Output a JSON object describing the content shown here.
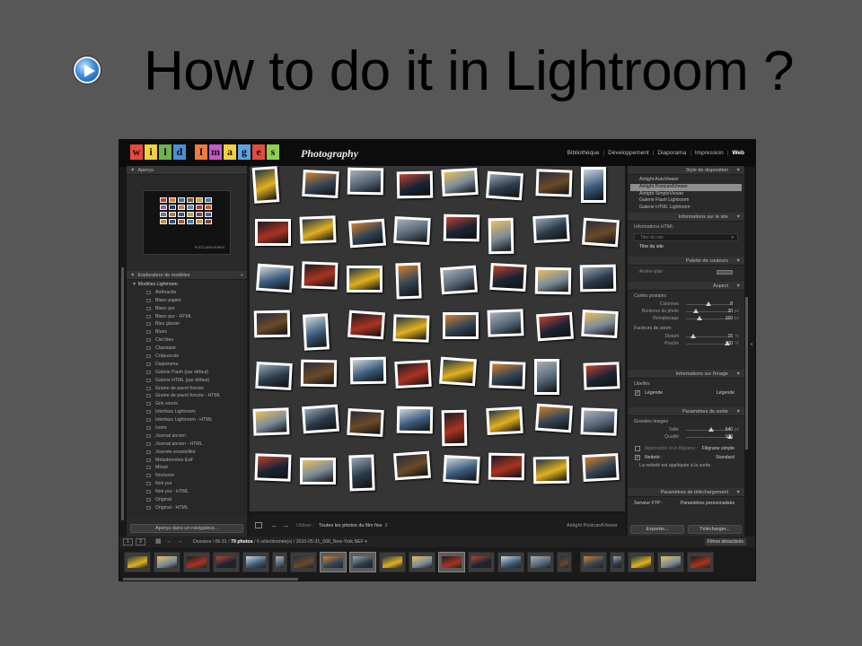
{
  "slide": {
    "title": "How to do it in Lightroom ?"
  },
  "lr": {
    "logo": [
      {
        "ch": "w",
        "bg": "#e64a3c"
      },
      {
        "ch": "i",
        "bg": "#f2d03a"
      },
      {
        "ch": "l",
        "bg": "#6fb24e"
      },
      {
        "ch": "d",
        "bg": "#4c8fd6"
      },
      {
        "ch": "",
        "bg": "transparent"
      },
      {
        "ch": "I",
        "bg": "#ef7c3a"
      },
      {
        "ch": "m",
        "bg": "#c45ac9"
      },
      {
        "ch": "a",
        "bg": "#f2d03a"
      },
      {
        "ch": "g",
        "bg": "#5aa6e0"
      },
      {
        "ch": "e",
        "bg": "#e64a3c"
      },
      {
        "ch": "s",
        "bg": "#8fd14f"
      }
    ],
    "logo_caption": "Photography",
    "modules": [
      {
        "label": "Bibliothèque",
        "active": false
      },
      {
        "label": "Développement",
        "active": false
      },
      {
        "label": "Diaporama",
        "active": false
      },
      {
        "label": "Impression",
        "active": false
      },
      {
        "label": "Web",
        "active": true
      }
    ],
    "left_panel": {
      "preview_header": "Aperçu",
      "preview_signature": "POSTCARDVIEWER",
      "explorer_header": "Explorateur de modèles",
      "folder": "Modèles Lightroom",
      "templates": [
        "Anthracite",
        "Blanc papier",
        "Blanc pur",
        "Blanc pur - HTML",
        "Bleu glacier",
        "Blues",
        "Ciel bleu",
        "Classique",
        "Crépuscule",
        "Diaporama",
        "Galerie Flash (par défaut)",
        "Galerie HTML (par défaut)",
        "Graine de pavot foncée",
        "Graine de pavot foncée - HTML",
        "Gris souris",
        "Interface Lightroom",
        "Interface Lightroom - HTML",
        "Ivoire",
        "Journal ancien",
        "Journal ancien - HTML",
        "Journée ensoleillée",
        "Métadonnées Exif",
        "Minuit",
        "Nocturne",
        "Noir pur",
        "Noir pur - HTML",
        "Original",
        "Original - HTML"
      ],
      "preview_button": "Aperçu dans un navigateur..."
    },
    "center": {
      "utiliser_label": "Utiliser :",
      "utiliser_value": "Toutes les photos du film fixe",
      "template_name": "Airtight PostcardViewer"
    },
    "right_panel": {
      "style": {
        "header": "Style de disposition",
        "items": [
          "Airtight AutoViewer",
          "Airtight PostcardViewer",
          "Airtight SimpleViewer",
          "Galerie Flash Lightroom",
          "Galerie HTML Lightroom"
        ],
        "selected": 1
      },
      "site_info": {
        "header": "Informations sur le site",
        "label": "Informations HTML",
        "placeholder": "Titre du site",
        "value": "Titre du site"
      },
      "colors": {
        "header": "Palette de couleurs",
        "row": "Arrière-plan"
      },
      "aspect": {
        "header": "Aspect",
        "cards_label": "Cartes postales",
        "sliders": [
          {
            "name": "Colonnes",
            "value": "8",
            "unit": "",
            "pos": 0.5
          },
          {
            "name": "Bordures de photo",
            "value": "20",
            "unit": "px",
            "pos": 0.22
          },
          {
            "name": "Remplissage",
            "value": "160",
            "unit": "px",
            "pos": 0.3
          }
        ],
        "zoom_label": "Facteurs de zoom",
        "zoom": [
          {
            "name": "Distant",
            "value": "15",
            "unit": "%",
            "pos": 0.15
          },
          {
            "name": "Proche",
            "value": "100",
            "unit": "%",
            "pos": 0.92
          }
        ]
      },
      "image_info": {
        "header": "Informations sur l'image",
        "label": "Libellés",
        "check": "Légende",
        "check_value": "Légende"
      },
      "output": {
        "header": "Paramètres de sortie",
        "label": "Grandes images",
        "sliders": [
          {
            "name": "Taille",
            "value": "640",
            "unit": "px",
            "pos": 0.55
          },
          {
            "name": "Qualité",
            "value": "100",
            "unit": "",
            "pos": 0.98
          }
        ],
        "watermark": "Application d'un filigrane :",
        "watermark_value": "Filigrane simple",
        "sharpen": "Netteté :",
        "sharpen_value": "Standard",
        "note": "La netteté est appliquée à la sortie."
      },
      "upload": {
        "header": "Paramètres de téléchargement",
        "label": "Serveur FTP :",
        "value": "Paramètres personnalisés"
      },
      "export_button": "Exporter...",
      "upload_button": "Télécharger..."
    },
    "filmstrip": {
      "page1": "1",
      "page2": "2",
      "path": "Dossiers / 05-31 /",
      "count": "79 photos",
      "rest": "/ 6 sélectionnée(s) / 2010-05-31_008_New-York.NEF",
      "filter_label": "Filtre :",
      "filter_value": "Filtres désactivés"
    }
  }
}
